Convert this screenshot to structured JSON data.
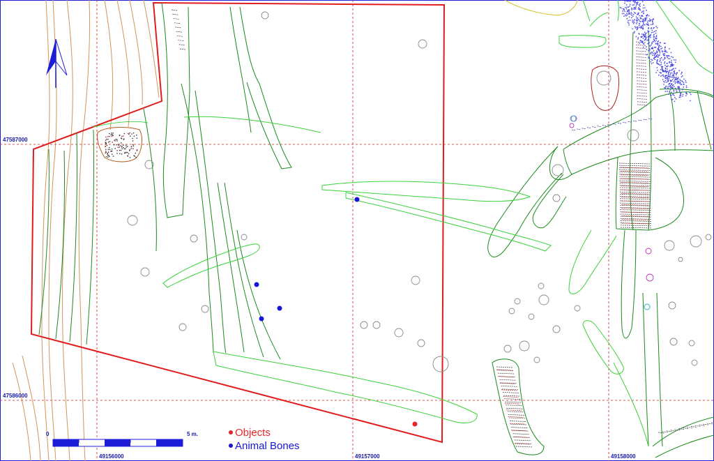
{
  "grid": {
    "x_labels": [
      "49156000",
      "49157000",
      "49158000"
    ],
    "y_labels": [
      "47587000",
      "47586000"
    ]
  },
  "scale_bar": {
    "start_label": "0",
    "end_label": "5 m."
  },
  "legend": {
    "objects": {
      "label": "Objects",
      "color": "#e8262b"
    },
    "animal_bones": {
      "label": "Animal Bones",
      "color": "#1616d4"
    }
  },
  "colors": {
    "boundary": "#e01c1c",
    "grid": "#d42020",
    "features": "#1a8a1a",
    "light_features": "#3ad23a",
    "contours": "#d4955a",
    "north_arrow": "#1d1dd8",
    "bone_cloud": "#4a4ae6"
  },
  "north_arrow": {
    "icon": "north-arrow-icon"
  }
}
